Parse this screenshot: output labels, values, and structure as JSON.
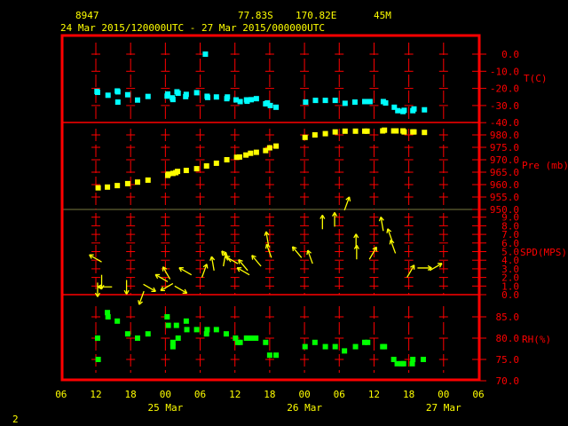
{
  "header": {
    "station_id": "8947",
    "latitude": "77.83S",
    "longitude": "170.82E",
    "elevation": "45M",
    "time_range": "24 Mar 2015/120000UTC - 27 Mar 2015/000000UTC"
  },
  "page_number": "2",
  "colors": {
    "frame": "#ff0000",
    "text": "#ffff00",
    "temp": "#00ffff",
    "pressure": "#ffff00",
    "wind": "#ffff00",
    "rh": "#00ff00"
  },
  "chart_data": {
    "type": "scatter",
    "x_axis": {
      "unit": "hours since 24 Mar 2015 12UTC",
      "range": [
        -6,
        66
      ],
      "tick_labels": [
        "06",
        "12",
        "18",
        "00",
        "06",
        "12",
        "18",
        "00",
        "06",
        "12",
        "18",
        "00",
        "06"
      ],
      "date_labels": [
        {
          "label": "25 Mar",
          "t": 12
        },
        {
          "label": "26 Mar",
          "t": 36
        },
        {
          "label": "27 Mar",
          "t": 60
        }
      ]
    },
    "panels": [
      {
        "name": "temperature",
        "ylabel": "T(C)",
        "ylim": [
          -40,
          0
        ],
        "tick_labels": [
          "0.0",
          "-10.0",
          "-20.0",
          "-30.0",
          "-40.0"
        ],
        "tick_values": [
          0,
          -10,
          -20,
          -30,
          -40
        ],
        "points": [
          [
            0.3,
            -22.3
          ],
          [
            0.2,
            -21.8
          ],
          [
            2.1,
            -24
          ],
          [
            3.8,
            -22
          ],
          [
            3.7,
            -21.5
          ],
          [
            3.8,
            -28
          ],
          [
            5.5,
            -23.7
          ],
          [
            7.2,
            -26.8
          ],
          [
            9,
            -24.7
          ],
          [
            12.4,
            -23.3
          ],
          [
            12.3,
            -24.5
          ],
          [
            13.3,
            -26.5
          ],
          [
            13.2,
            -25.5
          ],
          [
            14,
            -22
          ],
          [
            14.2,
            -22.8
          ],
          [
            15.6,
            -23.5
          ],
          [
            15.5,
            -24.8
          ],
          [
            17.4,
            -22.5
          ],
          [
            18.9,
            0
          ],
          [
            19.2,
            -24.6
          ],
          [
            19.3,
            -25.3
          ],
          [
            20.8,
            -25
          ],
          [
            22.6,
            -26
          ],
          [
            22.7,
            -25
          ],
          [
            24.2,
            -26.7
          ],
          [
            24.9,
            -27.7
          ],
          [
            26,
            -26.7
          ],
          [
            26.1,
            -27.5
          ],
          [
            26.8,
            -26.6
          ],
          [
            27.7,
            -26
          ],
          [
            29.3,
            -29
          ],
          [
            29.6,
            -28.5
          ],
          [
            30.1,
            -30
          ],
          [
            31.1,
            -31
          ],
          [
            36.2,
            -28
          ],
          [
            37.9,
            -27
          ],
          [
            39.6,
            -27
          ],
          [
            41.3,
            -27
          ],
          [
            43,
            -28.7
          ],
          [
            44.7,
            -28
          ],
          [
            46.4,
            -27.7
          ],
          [
            47.3,
            -27.7
          ],
          [
            49.6,
            -27.7
          ],
          [
            50,
            -28.5
          ],
          [
            51.5,
            -31
          ],
          [
            52.1,
            -33
          ],
          [
            53,
            -33.5
          ],
          [
            53.2,
            -32.8
          ],
          [
            54.7,
            -33
          ],
          [
            54.9,
            -32
          ],
          [
            56.7,
            -32.5
          ]
        ]
      },
      {
        "name": "pressure",
        "ylabel": "Pre (mb)",
        "ylim": [
          950,
          985
        ],
        "tick_labels": [
          "980.0",
          "975.0",
          "970.0",
          "965.0",
          "960.0",
          "955.0",
          "950.0"
        ],
        "tick_values": [
          980,
          975,
          970,
          965,
          960,
          955,
          950
        ],
        "points": [
          [
            0.4,
            958.7
          ],
          [
            2,
            959
          ],
          [
            3.7,
            959.6
          ],
          [
            5.5,
            960.4
          ],
          [
            7.2,
            961
          ],
          [
            9,
            961.8
          ],
          [
            12.4,
            963.7
          ],
          [
            12.5,
            964.2
          ],
          [
            13.3,
            964.5
          ],
          [
            13.8,
            964.8
          ],
          [
            14.1,
            965.3
          ],
          [
            15.6,
            965.7
          ],
          [
            17.4,
            966.4
          ],
          [
            19.1,
            967.5
          ],
          [
            20.8,
            968.6
          ],
          [
            22.6,
            970
          ],
          [
            24.3,
            971
          ],
          [
            24.8,
            971.1
          ],
          [
            25.9,
            971.9
          ],
          [
            26.7,
            972.6
          ],
          [
            27.7,
            973
          ],
          [
            29.3,
            973.7
          ],
          [
            30,
            974.8
          ],
          [
            31.1,
            975.5
          ],
          [
            36.1,
            979
          ],
          [
            37.8,
            980
          ],
          [
            39.6,
            980.5
          ],
          [
            41.3,
            981.2
          ],
          [
            43,
            981.5
          ],
          [
            44.8,
            981.5
          ],
          [
            46.4,
            981.5
          ],
          [
            46.8,
            981.5
          ],
          [
            49.5,
            981.6
          ],
          [
            49.8,
            981.9
          ],
          [
            51.4,
            981.6
          ],
          [
            51.8,
            981.6
          ],
          [
            53,
            981.6
          ],
          [
            53.2,
            981.2
          ],
          [
            54.7,
            981.2
          ],
          [
            54.9,
            981.2
          ],
          [
            56.7,
            981
          ]
        ]
      },
      {
        "name": "wind",
        "ylabel": "SPD(MPS)",
        "ylim": [
          0,
          10
        ],
        "tick_labels": [
          "9.0",
          "8.0",
          "7.0",
          "6.0",
          "5.0",
          "4.0",
          "3.0",
          "2.0",
          "1.0",
          "0.0"
        ],
        "tick_values": [
          9,
          8,
          7,
          6,
          5,
          4,
          3,
          2,
          1,
          0
        ],
        "points": [
          [
            1,
            3.8,
            300
          ],
          [
            1,
            2.3,
            180
          ],
          [
            0.3,
            1.4,
            180
          ],
          [
            2.8,
            0.9,
            270
          ],
          [
            5.3,
            1.7,
            180
          ],
          [
            8.2,
            1.2,
            120
          ],
          [
            8.3,
            0.4,
            200
          ],
          [
            12.4,
            1.5,
            300
          ],
          [
            12.8,
            1.8,
            330
          ],
          [
            13.3,
            1.3,
            240
          ],
          [
            13.6,
            1.0,
            120
          ],
          [
            16.5,
            2.3,
            300
          ],
          [
            18.3,
            2.0,
            20
          ],
          [
            20.4,
            2.8,
            350
          ],
          [
            22,
            3.3,
            10
          ],
          [
            23.3,
            3.8,
            320
          ],
          [
            24.5,
            3.6,
            300
          ],
          [
            26.2,
            2.8,
            320
          ],
          [
            26.5,
            2.3,
            300
          ],
          [
            28.5,
            3.3,
            320
          ],
          [
            29.8,
            5.7,
            350
          ],
          [
            30.3,
            4.3,
            340
          ],
          [
            35.5,
            4.3,
            320
          ],
          [
            37.4,
            3.6,
            340
          ],
          [
            39.1,
            7.6,
            0
          ],
          [
            41.2,
            7.9,
            0
          ],
          [
            42.9,
            9.8,
            20
          ],
          [
            44.9,
            5.4,
            0
          ],
          [
            45,
            4.1,
            0
          ],
          [
            47.2,
            4.1,
            30
          ],
          [
            49.6,
            7.4,
            350
          ],
          [
            51.2,
            6.1,
            340
          ],
          [
            51.7,
            4.8,
            340
          ],
          [
            53.7,
            2.0,
            30
          ],
          [
            55.5,
            3.1,
            90
          ],
          [
            57.6,
            2.8,
            60
          ]
        ]
      },
      {
        "name": "relative_humidity",
        "ylabel": "RH(%)",
        "ylim": [
          70,
          90
        ],
        "tick_labels": [
          "85.0",
          "80.0",
          "75.0",
          "70.0"
        ],
        "tick_values": [
          85,
          80,
          75,
          70
        ],
        "points": [
          [
            0.3,
            80
          ],
          [
            0.4,
            75
          ],
          [
            2,
            86
          ],
          [
            2.1,
            85
          ],
          [
            3.7,
            84
          ],
          [
            5.5,
            81
          ],
          [
            7.2,
            80
          ],
          [
            9,
            81
          ],
          [
            12.3,
            85
          ],
          [
            12.5,
            83
          ],
          [
            13.3,
            79
          ],
          [
            13.3,
            78
          ],
          [
            13.9,
            83
          ],
          [
            14.2,
            80
          ],
          [
            15.6,
            84
          ],
          [
            15.7,
            82
          ],
          [
            17.4,
            82
          ],
          [
            19.1,
            81
          ],
          [
            19.2,
            82
          ],
          [
            20.8,
            82
          ],
          [
            22.5,
            81
          ],
          [
            24.1,
            80
          ],
          [
            24.5,
            79
          ],
          [
            24.9,
            79
          ],
          [
            26,
            80
          ],
          [
            26.8,
            80
          ],
          [
            27.6,
            80
          ],
          [
            29.3,
            79
          ],
          [
            30,
            76
          ],
          [
            31.1,
            76
          ],
          [
            36.1,
            78
          ],
          [
            37.8,
            79
          ],
          [
            39.6,
            78
          ],
          [
            41.3,
            78
          ],
          [
            42.9,
            77
          ],
          [
            44.8,
            78
          ],
          [
            46.4,
            79
          ],
          [
            46.9,
            79
          ],
          [
            49.5,
            78
          ],
          [
            49.8,
            78
          ],
          [
            51.4,
            75
          ],
          [
            52,
            74
          ],
          [
            52.8,
            74
          ],
          [
            53.1,
            74
          ],
          [
            54.6,
            74
          ],
          [
            54.7,
            75
          ],
          [
            56.5,
            75
          ]
        ]
      }
    ]
  }
}
